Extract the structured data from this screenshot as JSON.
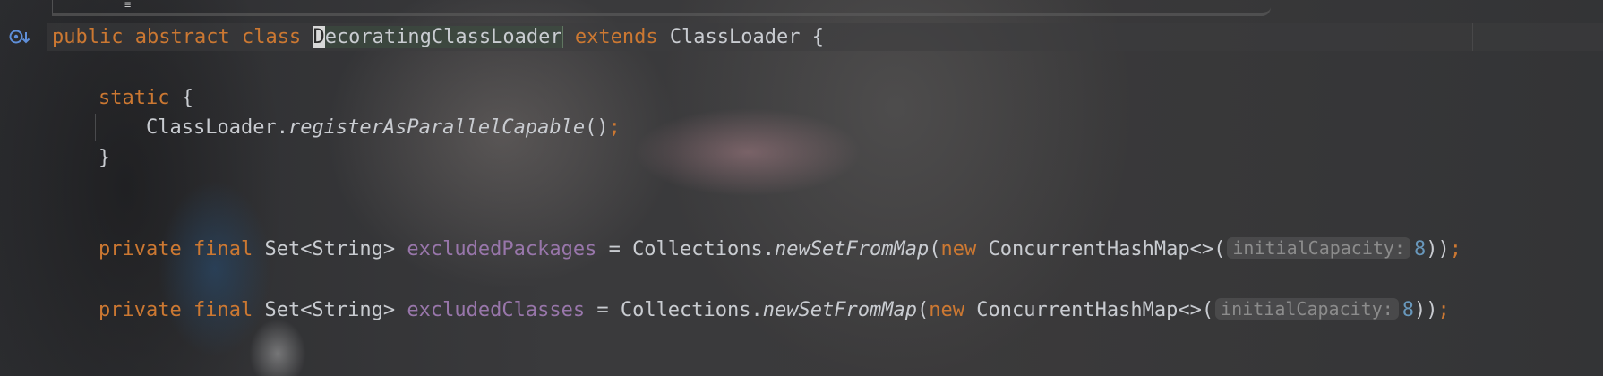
{
  "editor": {
    "lines": {
      "class_decl": {
        "kw_public": "public",
        "kw_abstract": "abstract",
        "kw_class": "class",
        "class_first_char": "D",
        "class_rest": "ecoratingClassLoader",
        "kw_extends": "extends",
        "super_name": "ClassLoader",
        "brace": "{"
      },
      "static_open": {
        "kw_static": "static",
        "brace": "{"
      },
      "static_body": {
        "receiver": "ClassLoader.",
        "method": "registerAsParallelCapable",
        "parens": "()",
        "semicolon": ";"
      },
      "static_close": {
        "brace": "}"
      },
      "field_packages": {
        "kw_private": "private",
        "kw_final": "final",
        "type": "Set<String>",
        "name": "excludedPackages",
        "assign": " = Collections.",
        "method": "newSetFromMap",
        "open": "(",
        "kw_new": "new",
        "ctor": " ConcurrentHashMap<>(",
        "hint": "initialCapacity:",
        "num": "8",
        "close": "))",
        "semicolon": ";"
      },
      "field_classes": {
        "kw_private": "private",
        "kw_final": "final",
        "type": "Set<String>",
        "name": "excludedClasses",
        "assign": " = Collections.",
        "method": "newSetFromMap",
        "open": "(",
        "kw_new": "new",
        "ctor": " ConcurrentHashMap<>(",
        "hint": "initialCapacity:",
        "num": "8",
        "close": "))",
        "semicolon": ";"
      }
    },
    "gutter_icon": "implemented-override-icon",
    "top_scroll_glyph": "≡",
    "colors": {
      "keyword": "#cc7832",
      "field": "#9876aa",
      "number": "#6897bb",
      "text": "#c9ccd1"
    }
  }
}
